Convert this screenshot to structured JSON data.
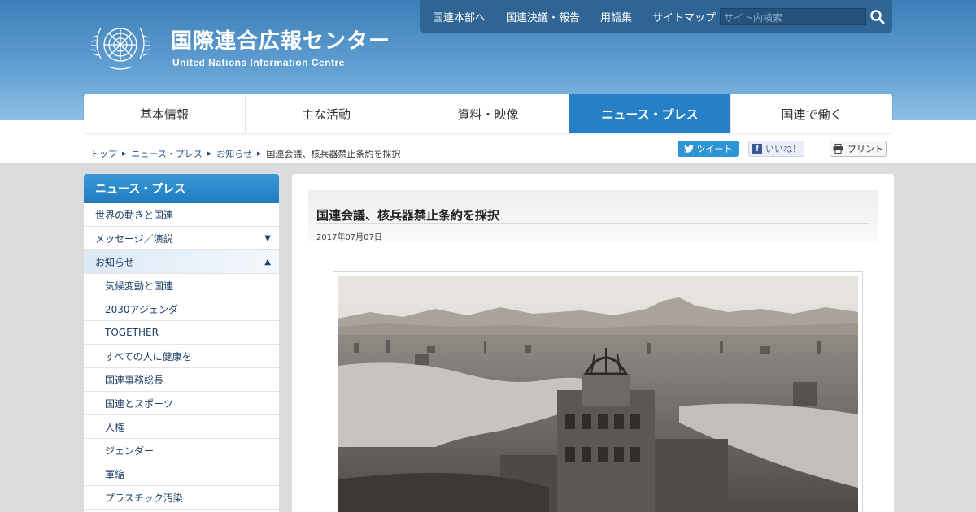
{
  "header": {
    "title": "国際連合広報センター",
    "subtitle": "United Nations Information Centre",
    "logo": "un-emblem-icon"
  },
  "utility_nav": {
    "items": [
      "国連本部へ",
      "国連決議・報告",
      "用語集",
      "サイトマップ"
    ],
    "search_placeholder": "サイト内検索",
    "search_icon": "search-icon"
  },
  "main_nav": {
    "items": [
      {
        "label": "基本情報",
        "active": false
      },
      {
        "label": "主な活動",
        "active": false
      },
      {
        "label": "資料・映像",
        "active": false
      },
      {
        "label": "ニュース・プレス",
        "active": true
      },
      {
        "label": "国連で働く",
        "active": false
      }
    ]
  },
  "breadcrumb": {
    "items": [
      "トップ",
      "ニュース・プレス",
      "お知らせ"
    ],
    "current": "国連会議、核兵器禁止条約を採択"
  },
  "share": {
    "tweet": "ツイート",
    "like": "いいね！",
    "print": "プリント"
  },
  "sidebar": {
    "heading": "ニュース・プレス",
    "items": [
      {
        "label": "世界の動きと国連",
        "arrow": ""
      },
      {
        "label": "メッセージ／演説",
        "arrow": "▼"
      },
      {
        "label": "お知らせ",
        "arrow": "▲"
      }
    ],
    "subitems": [
      "気候変動と国連",
      "2030アジェンダ",
      "TOGETHER",
      "すべての人に健康を",
      "国連事務総長",
      "国連とスポーツ",
      "人権",
      "ジェンダー",
      "軍縮",
      "プラスチック汚染"
    ]
  },
  "article": {
    "title": "国連会議、核兵器禁止条約を採択",
    "date": "2017年07月07日"
  },
  "colors": {
    "header_top": "#3d7fb8",
    "accent": "#2680c5",
    "link": "#234f84"
  }
}
